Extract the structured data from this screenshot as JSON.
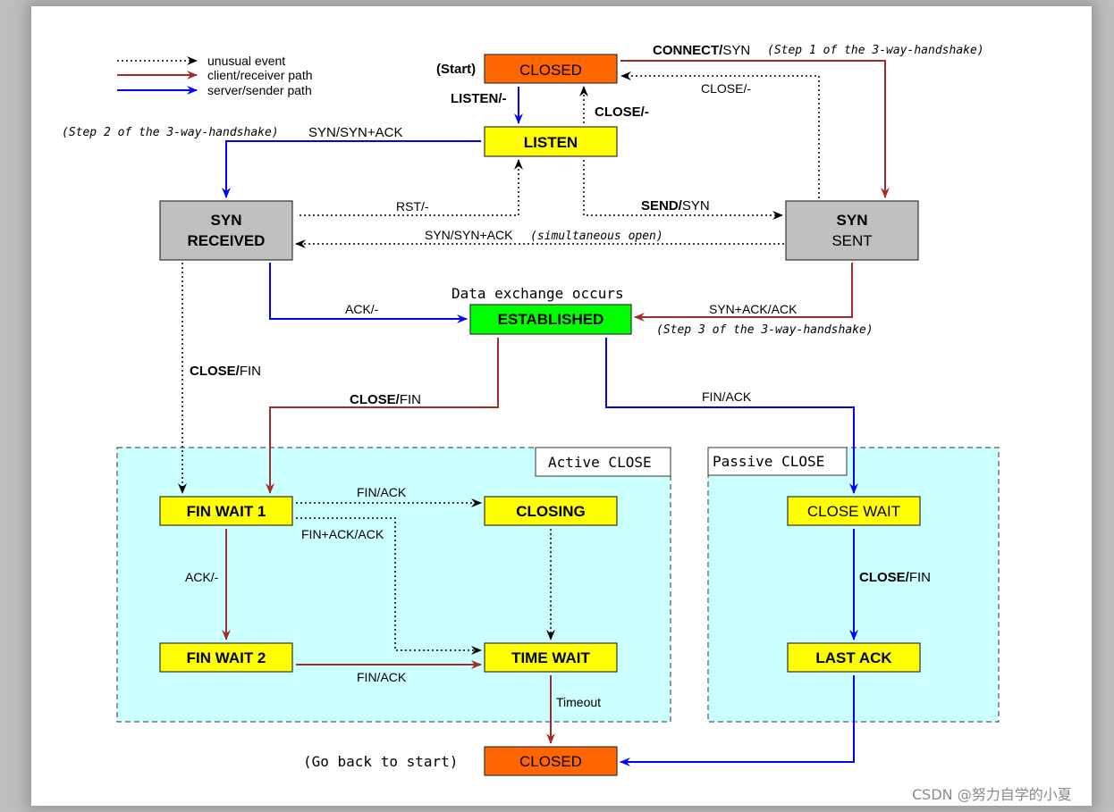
{
  "colors": {
    "closed": "#ff6600",
    "normal": "#ffff00",
    "syn": "#c0c0c0",
    "established": "#00ff00",
    "close_region": "#ccffff",
    "client_path": "#a52a2a",
    "server_path": "#0000ff",
    "unusual": "#000000"
  },
  "legend": {
    "unusual": "unusual event",
    "client": "client/receiver path",
    "server": "server/sender path"
  },
  "states": {
    "closed_top": "CLOSED",
    "listen": "LISTEN",
    "syn_received_1": "SYN",
    "syn_received_2": "RECEIVED",
    "syn_sent_1": "SYN",
    "syn_sent_2": "SENT",
    "established": "ESTABLISHED",
    "fin_wait_1": "FIN WAIT 1",
    "closing": "CLOSING",
    "fin_wait_2": "FIN WAIT 2",
    "time_wait": "TIME WAIT",
    "close_wait": "CLOSE WAIT",
    "last_ack": "LAST ACK",
    "closed_bottom": "CLOSED"
  },
  "notes": {
    "start": "(Start)",
    "go_back": "(Go back to start)",
    "data_exchange": "Data exchange occurs",
    "step1": "(Step 1 of the 3-way-handshake)",
    "step2": "(Step 2 of the 3-way-handshake)",
    "step3": "(Step 3 of the 3-way-handshake)",
    "simultaneous": "(simultaneous open)",
    "active_close": "Active CLOSE",
    "passive_close": "Passive CLOSE"
  },
  "transitions": {
    "connect": {
      "bold": "CONNECT/",
      "normal": "SYN"
    },
    "listen": {
      "bold": "LISTEN/-",
      "normal": ""
    },
    "close_listen": {
      "bold": "CLOSE/-",
      "normal": ""
    },
    "close_synsent": "CLOSE/-",
    "syn_synack": "SYN/SYN+ACK",
    "rst": "RST/-",
    "send": {
      "bold": "SEND/",
      "normal": "SYN"
    },
    "syn_synack_sim": "SYN/SYN+ACK",
    "ack": "ACK/-",
    "synack_ack": "SYN+ACK/ACK",
    "close_fin_synrcvd": {
      "bold": "CLOSE/",
      "normal": "FIN"
    },
    "close_fin_est": {
      "bold": "CLOSE/",
      "normal": "FIN"
    },
    "fin_ack_est": "FIN/ACK",
    "fin_ack_fw1": "FIN/ACK",
    "finack_ack": "FIN+ACK/ACK",
    "ack_fw1": "ACK/-",
    "fin_ack_fw2": "FIN/ACK",
    "timeout": "Timeout",
    "close_fin_cw": {
      "bold": "CLOSE/",
      "normal": "FIN"
    }
  },
  "watermark": "CSDN @努力自学的小夏"
}
